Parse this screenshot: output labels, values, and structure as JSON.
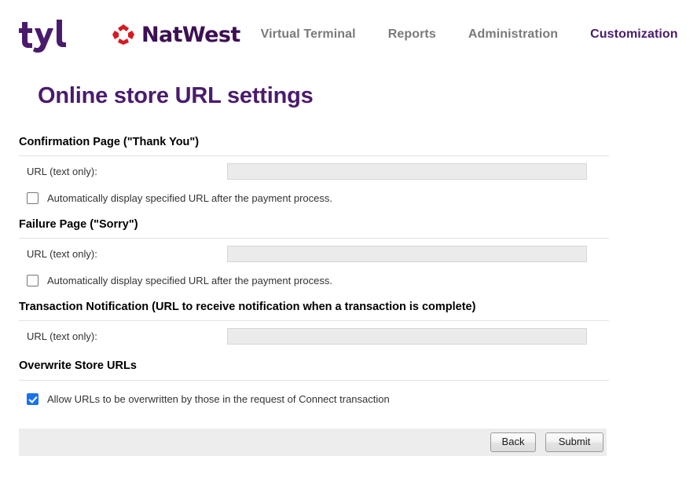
{
  "brand": {
    "tyl_logo_name": "tyl",
    "natwest_word": "NatWest",
    "natwest_mark_name": "natwest-cube-icon",
    "purple": "#3c1053",
    "red": "#d71921",
    "title_purple": "#4a1b6d",
    "nav_gray": "#7a7a7a",
    "checkbox_blue": "#1a73e8"
  },
  "nav": {
    "items": [
      {
        "label": "Virtual Terminal",
        "active": false
      },
      {
        "label": "Reports",
        "active": false
      },
      {
        "label": "Administration",
        "active": false
      },
      {
        "label": "Customization",
        "active": true
      }
    ]
  },
  "page": {
    "title": "Online store URL settings"
  },
  "sections": [
    {
      "heading": "Confirmation Page (\"Thank You\")",
      "field_label": "URL (text only):",
      "field_value": "",
      "field_placeholder": "",
      "checkbox_label": "Automatically display specified URL after the payment process.",
      "checkbox_checked": false
    },
    {
      "heading": "Failure Page (\"Sorry\")",
      "field_label": "URL (text only):",
      "field_value": "",
      "field_placeholder": "",
      "checkbox_label": "Automatically display specified URL after the payment process.",
      "checkbox_checked": false
    },
    {
      "heading": "Transaction Notification (URL to receive notification when a transaction is complete)",
      "field_label": "URL (text only):",
      "field_value": "",
      "field_placeholder": "",
      "checkbox_label": "",
      "checkbox_checked": false
    },
    {
      "heading": "Overwrite Store URLs",
      "field_label": "",
      "field_value": "",
      "field_placeholder": "",
      "checkbox_label": "Allow URLs to be overwritten by those in the request of Connect transaction",
      "checkbox_checked": true
    }
  ],
  "footer": {
    "back_label": "Back",
    "submit_label": "Submit"
  }
}
